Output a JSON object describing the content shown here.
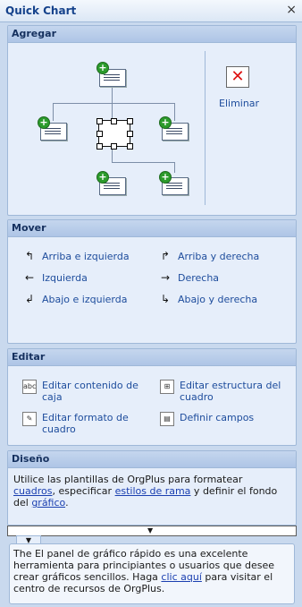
{
  "window": {
    "title": "Quick Chart",
    "close_label": "×"
  },
  "agregar": {
    "header": "Agregar",
    "delete_label": "Eliminar"
  },
  "mover": {
    "header": "Mover",
    "items": [
      {
        "label": "Arriba e izquierda",
        "icon": "up-left-arrow-icon"
      },
      {
        "label": "Arriba y derecha",
        "icon": "up-right-arrow-icon"
      },
      {
        "label": "Izquierda",
        "icon": "left-arrow-icon"
      },
      {
        "label": "Derecha",
        "icon": "right-arrow-icon"
      },
      {
        "label": "Abajo e izquierda",
        "icon": "down-left-arrow-icon"
      },
      {
        "label": "Abajo y derecha",
        "icon": "down-right-arrow-icon"
      }
    ]
  },
  "editar": {
    "header": "Editar",
    "items": [
      {
        "label": "Editar contenido de caja",
        "icon": "edit-box-content-icon"
      },
      {
        "label": "Editar estructura del cuadro",
        "icon": "edit-chart-structure-icon"
      },
      {
        "label": "Editar formato de cuadro",
        "icon": "edit-chart-format-icon"
      },
      {
        "label": "Definir campos",
        "icon": "define-fields-icon"
      }
    ]
  },
  "diseno": {
    "header": "Diseño",
    "text1": "Utilice las plantillas de OrgPlus para formatear",
    "link1": "cuadros",
    "text2": ", especificar ",
    "link2": "estilos de rama",
    "text3": " y definir el fondo del ",
    "link3": "gráfico",
    "text4": "."
  },
  "info": {
    "text1": "The El panel de gráfico rápido es una excelente herramienta para principiantes o usuarios que desee crear gráficos sencillos. Haga ",
    "link": "clic aquí",
    "text2": " para visitar el centro de recursos de OrgPlus."
  }
}
